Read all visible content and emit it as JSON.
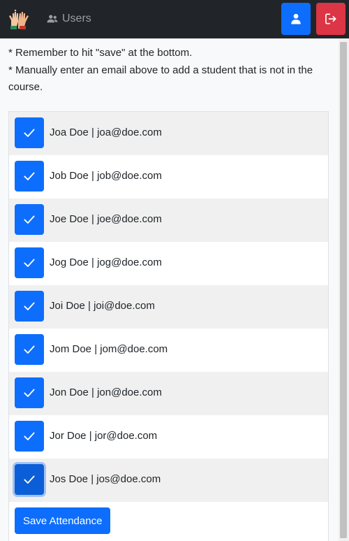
{
  "navbar": {
    "nav_users_label": "Users",
    "icons": {
      "logo": "raised-hands-logo-icon",
      "users": "people-icon",
      "profile": "person-icon",
      "logout": "logout-icon"
    },
    "colors": {
      "bg": "#212529",
      "profile": "#0d6efd",
      "logout": "#dc3545"
    }
  },
  "notes": [
    "* Remember to hit \"save\" at the bottom.",
    "* Manually enter an email above to add a student that is not in the course."
  ],
  "students": [
    {
      "label": "Joa Doe | joa@doe.com",
      "checked": true
    },
    {
      "label": "Job Doe | job@doe.com",
      "checked": true
    },
    {
      "label": "Joe Doe | joe@doe.com",
      "checked": true
    },
    {
      "label": "Jog Doe | jog@doe.com",
      "checked": true
    },
    {
      "label": "Joi Doe | joi@doe.com",
      "checked": true
    },
    {
      "label": "Jom Doe | jom@doe.com",
      "checked": true
    },
    {
      "label": "Jon Doe | jon@doe.com",
      "checked": true
    },
    {
      "label": "Jor Doe | jor@doe.com",
      "checked": true
    },
    {
      "label": "Jos Doe | jos@doe.com",
      "checked": true,
      "focused": true
    }
  ],
  "save_button_label": "Save Attendance",
  "accent": "#0d6efd"
}
